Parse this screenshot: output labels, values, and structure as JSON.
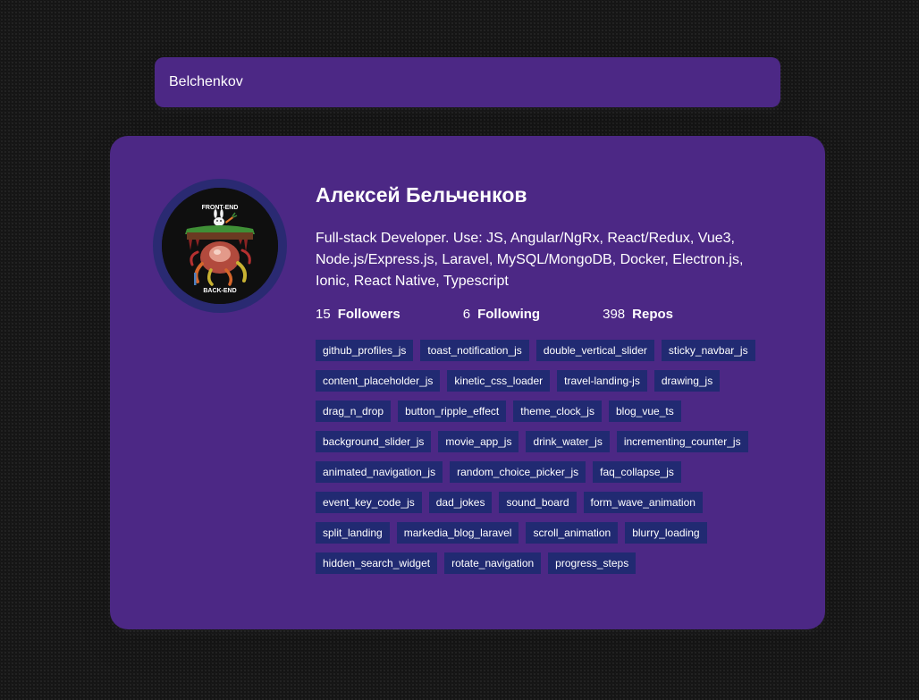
{
  "search": {
    "value": "Belchenkov"
  },
  "profile": {
    "name": "Алексей Бельченков",
    "bio": "Full-stack Developer. Use: JS, Angular/NgRx, React/Redux, Vue3, Node.js/Express.js, Laravel, MySQL/MongoDB, Docker, Electron.js, Ionic, React Native, Typescript",
    "avatar_text_top": "FRONT-END",
    "avatar_text_bottom": "BACK-END",
    "stats": {
      "followers_value": "15",
      "followers_label": "Followers",
      "following_value": "6",
      "following_label": "Following",
      "repos_value": "398",
      "repos_label": "Repos"
    },
    "repos": [
      "github_profiles_js",
      "toast_notification_js",
      "double_vertical_slider",
      "sticky_navbar_js",
      "content_placeholder_js",
      "kinetic_css_loader",
      "travel-landing-js",
      "drawing_js",
      "drag_n_drop",
      "button_ripple_effect",
      "theme_clock_js",
      "blog_vue_ts",
      "background_slider_js",
      "movie_app_js",
      "drink_water_js",
      "incrementing_counter_js",
      "animated_navigation_js",
      "random_choice_picker_js",
      "faq_collapse_js",
      "event_key_code_js",
      "dad_jokes",
      "sound_board",
      "form_wave_animation",
      "split_landing",
      "markedia_blog_laravel",
      "scroll_animation",
      "blurry_loading",
      "hidden_search_widget",
      "rotate_navigation",
      "progress_steps"
    ]
  },
  "colors": {
    "background": "#151515",
    "card": "#4c2885",
    "avatar_border": "#2a2a72",
    "repo_tag": "#212a72",
    "text": "#ffffff"
  }
}
